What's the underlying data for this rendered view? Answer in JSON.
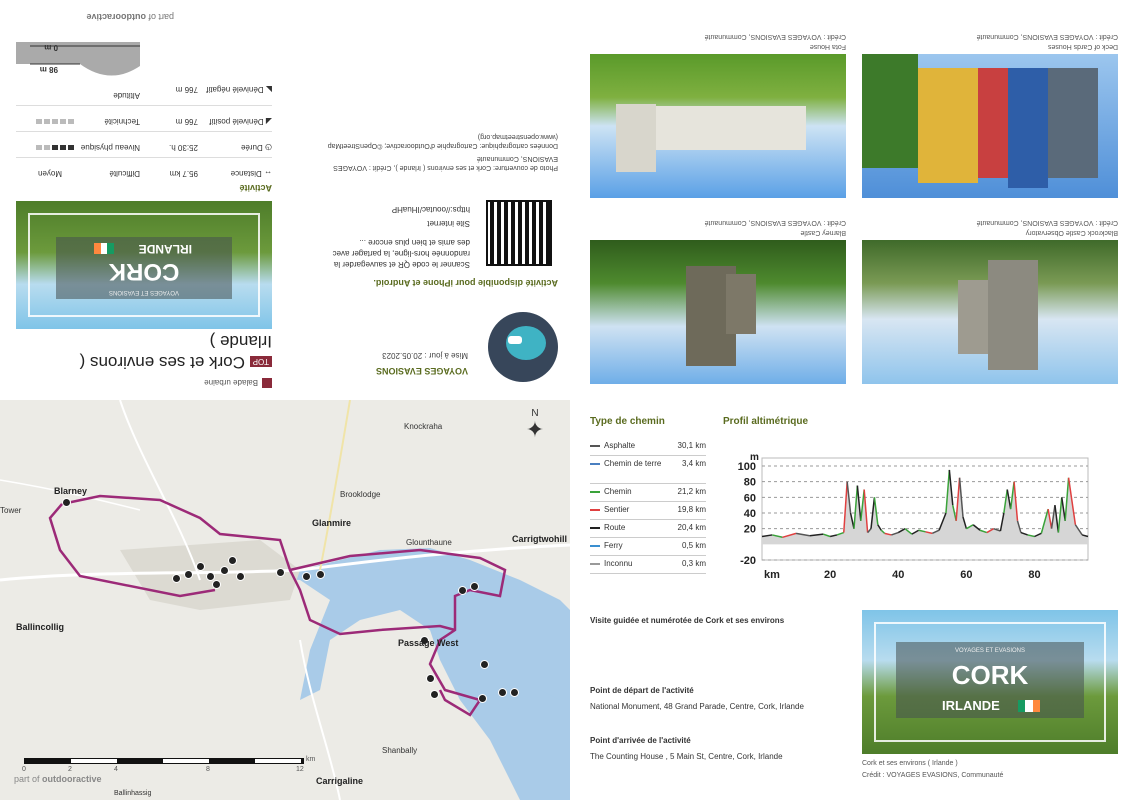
{
  "branding": {
    "part_of": "part of",
    "brand": "outdooractive"
  },
  "activity": {
    "category": "Balade urbaine",
    "top_badge": "TOP",
    "title_line1": "Cork et ses environs (",
    "title_line2": "Irlande )",
    "section_label": "Activité",
    "stats": {
      "distance_label": "Distance",
      "distance_value": "95.7",
      "distance_unit": "km",
      "difficulty_label": "Difficulté",
      "difficulty_value": "Moyen",
      "duration_label": "Durée",
      "duration_value": "25:30",
      "duration_unit": "h.",
      "physical_label": "Niveau physique",
      "physical_dots": 5,
      "physical_on": 3,
      "ascent_label": "Dénivelé positif",
      "ascent_value": "766",
      "ascent_unit": "m",
      "technique_label": "Technicité",
      "technique_dots": 5,
      "technique_on": 0,
      "descent_label": "Dénivelé négatif",
      "descent_value": "766",
      "descent_unit": "m",
      "altitude_label": "Altitude",
      "alt_max": "98 m",
      "alt_min": "0 m"
    }
  },
  "cover": {
    "subtitle": "VOYAGES ET EVASIONS",
    "city": "CORK",
    "country": "IRLANDE"
  },
  "publisher": {
    "name": "VOYAGES EVASIONS",
    "updated": "Mise à jour : 20.05.2023",
    "app_heading": "Activité disponible pour iPhone et Android.",
    "qr_text": "Scanner le code QR et sauvegarder la randonnée hors-ligne, la partager avec des amis et bien plus encore ...",
    "site_label": "Site internet",
    "site_url": "https://ooutac/IHuaHP",
    "photo_credit": "Photo de couverture: Cork et ses environs ( Irlande ), Crédit : VOYAGES EVASIONS, Communauté",
    "map_credit": "Données cartographique: Cartographie d'Outdooractive; ©OpenStreetMap (www.openstreetmap.org)"
  },
  "photos": [
    {
      "caption": "Fota House",
      "credit": "Crédit : VOYAGES EVASIONS, Communauté"
    },
    {
      "caption": "Deck of Cards Houses",
      "credit": "Crédit : VOYAGES EVASIONS, Communauté"
    },
    {
      "caption": "Blarney Castle",
      "credit": "Crédit : VOYAGES EVASIONS, Communauté"
    },
    {
      "caption": "Blackrock Castle Observatory",
      "credit": "Crédit : VOYAGES EVASIONS, Communauté"
    }
  ],
  "map": {
    "north": "N",
    "labels": [
      "Knockraha",
      "Blarney",
      "Brooklodge",
      "Tower",
      "Glanmire",
      "Glounthaune",
      "Carrigtwohill",
      "Ballincollig",
      "Passage West",
      "Shanbally",
      "Carrigaline",
      "Ballinhassig"
    ],
    "scale_ticks": [
      "0",
      "2",
      "4",
      "8",
      "12"
    ],
    "scale_unit": "km",
    "part_of": "part of",
    "brand": "outdooractive"
  },
  "path_types": {
    "heading": "Type de chemin",
    "rows": [
      {
        "name": "Asphalte",
        "km": "30,1 km",
        "color": "#555555"
      },
      {
        "name": "Chemin de terre",
        "km": "3,4 km",
        "color": "#4a7fc0"
      },
      {
        "name": "Chemin",
        "km": "21,2 km",
        "color": "#3aa33a"
      },
      {
        "name": "Sentier",
        "km": "19,8 km",
        "color": "#e04040"
      },
      {
        "name": "Route",
        "km": "20,4 km",
        "color": "#222222"
      },
      {
        "name": "Ferry",
        "km": "0,5 km",
        "color": "#3a8fd0"
      },
      {
        "name": "Inconnu",
        "km": "0,3 km",
        "color": "#999999"
      }
    ]
  },
  "chart_data": {
    "type": "area",
    "title": "Profil altimétrique",
    "ylabel": "m",
    "xlabel": "km",
    "ylim": [
      -20,
      100
    ],
    "xlim": [
      0,
      95.7
    ],
    "yticks": [
      "100",
      "80",
      "60",
      "40",
      "20",
      "-20"
    ],
    "xticks": [
      "20",
      "40",
      "60",
      "80"
    ],
    "grid": true,
    "x": [
      0,
      3,
      6,
      10,
      14,
      18,
      20,
      22,
      24,
      25,
      26,
      27,
      28,
      29,
      30,
      31,
      32,
      33,
      34,
      35,
      36,
      38,
      40,
      42,
      44,
      46,
      48,
      50,
      52,
      54,
      55,
      56,
      57,
      58,
      59,
      60,
      62,
      64,
      66,
      68,
      70,
      71,
      72,
      73,
      74,
      75,
      76,
      78,
      80,
      82,
      84,
      85,
      86,
      87,
      88,
      89,
      90,
      92,
      94,
      95.7
    ],
    "y": [
      10,
      12,
      9,
      14,
      11,
      13,
      10,
      12,
      15,
      80,
      40,
      20,
      75,
      30,
      70,
      15,
      20,
      60,
      25,
      18,
      14,
      12,
      15,
      20,
      13,
      18,
      16,
      14,
      18,
      40,
      95,
      50,
      30,
      85,
      35,
      20,
      25,
      18,
      15,
      20,
      17,
      40,
      70,
      45,
      80,
      30,
      15,
      12,
      10,
      14,
      45,
      20,
      50,
      15,
      60,
      30,
      85,
      25,
      12,
      10
    ]
  },
  "info": {
    "guided_title": "Visite guidée et numérotée de Cork et ses environs",
    "start_heading": "Point de départ de l'activité",
    "start_address": "National Monument, 48 Grand Parade, Centre, Cork, Irlande",
    "end_heading": "Point d'arrivée de l'activité",
    "end_address": "The Counting House , 5 Main St, Centre, Cork, Irlande",
    "cover_caption": "Cork et ses environs ( Irlande )",
    "cover_credit": "Crédit : VOYAGES EVASIONS, Communauté"
  },
  "colors": {
    "route": "#9c2a78",
    "water": "#a9cbe8",
    "olive": "#5a6b1f",
    "flag_green": "#169b62",
    "flag_orange": "#ff883e"
  }
}
